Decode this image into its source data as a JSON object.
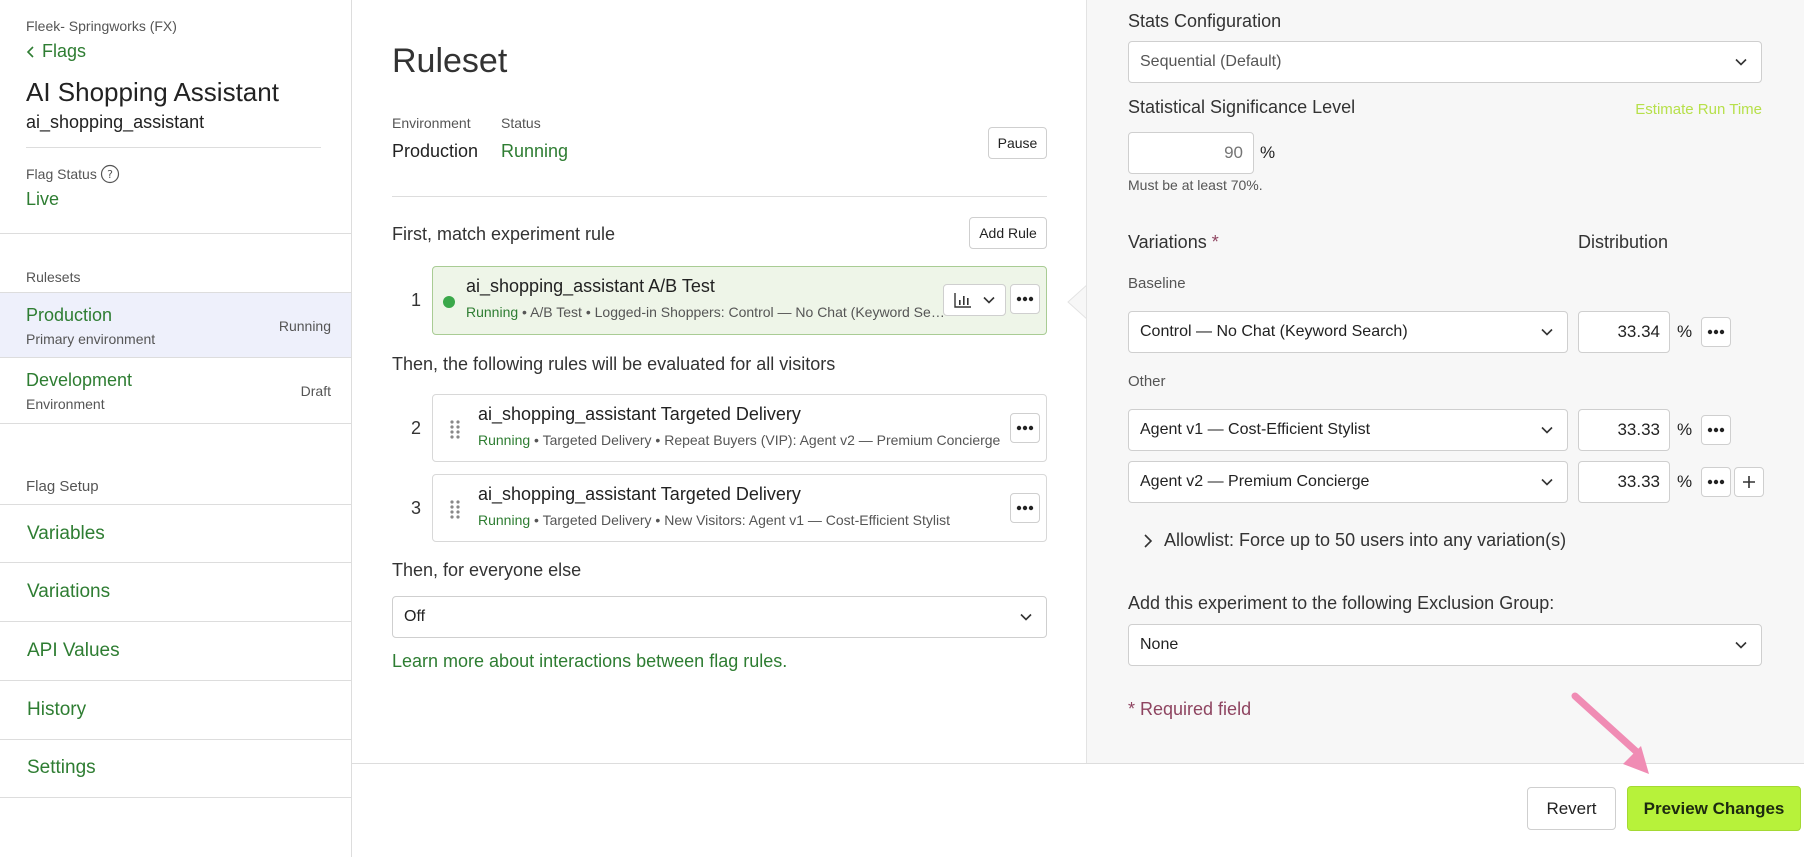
{
  "sidebar": {
    "project": "Fleek- Springworks (FX)",
    "back_label": "Flags",
    "flag_name": "AI Shopping Assistant",
    "flag_key": "ai_shopping_assistant",
    "flag_status_label": "Flag Status",
    "flag_status_value": "Live",
    "rulesets_heading": "Rulesets",
    "rulesets": [
      {
        "name": "Production",
        "sub": "Primary environment",
        "status": "Running"
      },
      {
        "name": "Development",
        "sub": "Environment",
        "status": "Draft"
      }
    ],
    "setup_heading": "Flag Setup",
    "setup_items": [
      "Variables",
      "Variations",
      "API Values",
      "History",
      "Settings"
    ]
  },
  "ruleset": {
    "title": "Ruleset",
    "env_label": "Environment",
    "env_value": "Production",
    "status_label": "Status",
    "status_value": "Running",
    "pause_label": "Pause",
    "first_heading": "First, match experiment rule",
    "add_rule_label": "Add Rule",
    "then_heading": "Then, the following rules will be evaluated for all visitors",
    "else_heading": "Then, for everyone else",
    "else_value": "Off",
    "learn_more": "Learn more about interactions between flag rules.",
    "rules": [
      {
        "num": "1",
        "title": "ai_shopping_assistant A/B Test",
        "status": "Running",
        "desc": " • A/B Test • Logged-in Shoppers: Control — No Chat (Keyword Search)"
      },
      {
        "num": "2",
        "title": "ai_shopping_assistant Targeted Delivery",
        "status": "Running",
        "desc": " • Targeted Delivery • Repeat Buyers (VIP): Agent v2 — Premium Concierge"
      },
      {
        "num": "3",
        "title": "ai_shopping_assistant Targeted Delivery",
        "status": "Running",
        "desc": " • Targeted Delivery • New Visitors: Agent v1 — Cost-Efficient Stylist"
      }
    ]
  },
  "config": {
    "stats_label": "Stats Configuration",
    "stats_value": "Sequential (Default)",
    "sig_label": "Statistical Significance Level",
    "estimate_link": "Estimate Run Time",
    "sig_placeholder": "90",
    "pct": "%",
    "sig_help": "Must be at least 70%.",
    "variations_label": "Variations",
    "required_star": "*",
    "distribution_label": "Distribution",
    "baseline_label": "Baseline",
    "other_label": "Other",
    "variations": [
      {
        "name": "Control — No Chat (Keyword Search)",
        "dist": "33.34"
      },
      {
        "name": "Agent v1 — Cost-Efficient Stylist",
        "dist": "33.33"
      },
      {
        "name": "Agent v2 — Premium Concierge",
        "dist": "33.33"
      }
    ],
    "allowlist_label": "Allowlist: Force up to 50 users into any variation(s)",
    "exclusion_label": "Add this experiment to the following Exclusion Group:",
    "exclusion_value": "None",
    "required_note": "* Required field"
  },
  "footer": {
    "revert_label": "Revert",
    "preview_label": "Preview Changes"
  },
  "colors": {
    "accent_green": "#2e7d32",
    "preview_bg": "#b7f23a",
    "selected_row_bg": "#eef0fb",
    "rule1_bg": "#eef5e8",
    "required": "#8e4460",
    "annotation_arrow": "#f08cb4"
  }
}
